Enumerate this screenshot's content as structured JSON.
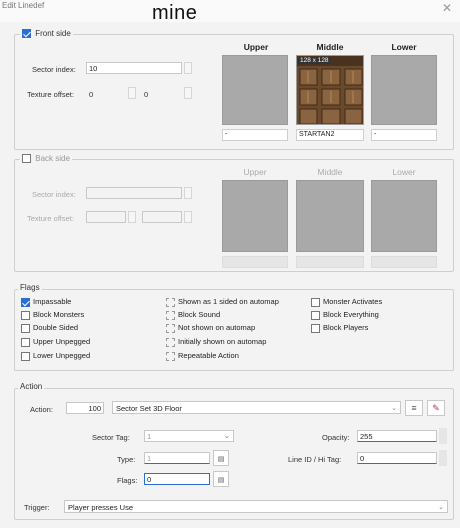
{
  "window": {
    "title": "Edit Linedef",
    "caption": "mine"
  },
  "front": {
    "checkbox_label": "Front side",
    "checked": true,
    "sector_index_label": "Sector index:",
    "sector_index_value": "10",
    "texture_offset_label": "Texture offset:",
    "offset_x": "0",
    "offset_y": "0",
    "columns": [
      "Upper",
      "Middle",
      "Lower"
    ],
    "textures": [
      {
        "name": "-"
      },
      {
        "name": "STARTAN2",
        "size": "128 x 128"
      },
      {
        "name": "-"
      }
    ]
  },
  "back": {
    "checkbox_label": "Back side",
    "checked": false,
    "sector_index_label": "Sector index:",
    "texture_offset_label": "Texture offset:",
    "columns": [
      "Upper",
      "Middle",
      "Lower"
    ]
  },
  "flags": {
    "title": "Flags",
    "col1": [
      {
        "label": "Impassable",
        "checked": true
      },
      {
        "label": "Block Monsters",
        "checked": false
      },
      {
        "label": "Double Sided",
        "checked": false
      },
      {
        "label": "Upper Unpegged",
        "checked": false
      },
      {
        "label": "Lower Unpegged",
        "checked": false
      }
    ],
    "col2": [
      {
        "label": "Shown as 1 sided on automap"
      },
      {
        "label": "Block Sound"
      },
      {
        "label": "Not shown on automap"
      },
      {
        "label": "Initially shown on automap"
      },
      {
        "label": "Repeatable Action"
      }
    ],
    "col3": [
      {
        "label": "Monster Activates"
      },
      {
        "label": "Block Everything"
      },
      {
        "label": "Block Players"
      }
    ]
  },
  "action": {
    "title": "Action",
    "action_label": "Action:",
    "action_number": "100",
    "action_name": "Sector Set 3D Floor",
    "sector_tag_label": "Sector Tag:",
    "sector_tag_value": "1",
    "type_label": "Type:",
    "type_value": "1",
    "flags_label": "Flags:",
    "flags_value": "0",
    "opacity_label": "Opacity:",
    "opacity_value": "255",
    "line_id_label": "Line ID / Hi Tag:",
    "line_id_value": "0",
    "trigger_label": "Trigger:",
    "trigger_value": "Player presses Use"
  }
}
